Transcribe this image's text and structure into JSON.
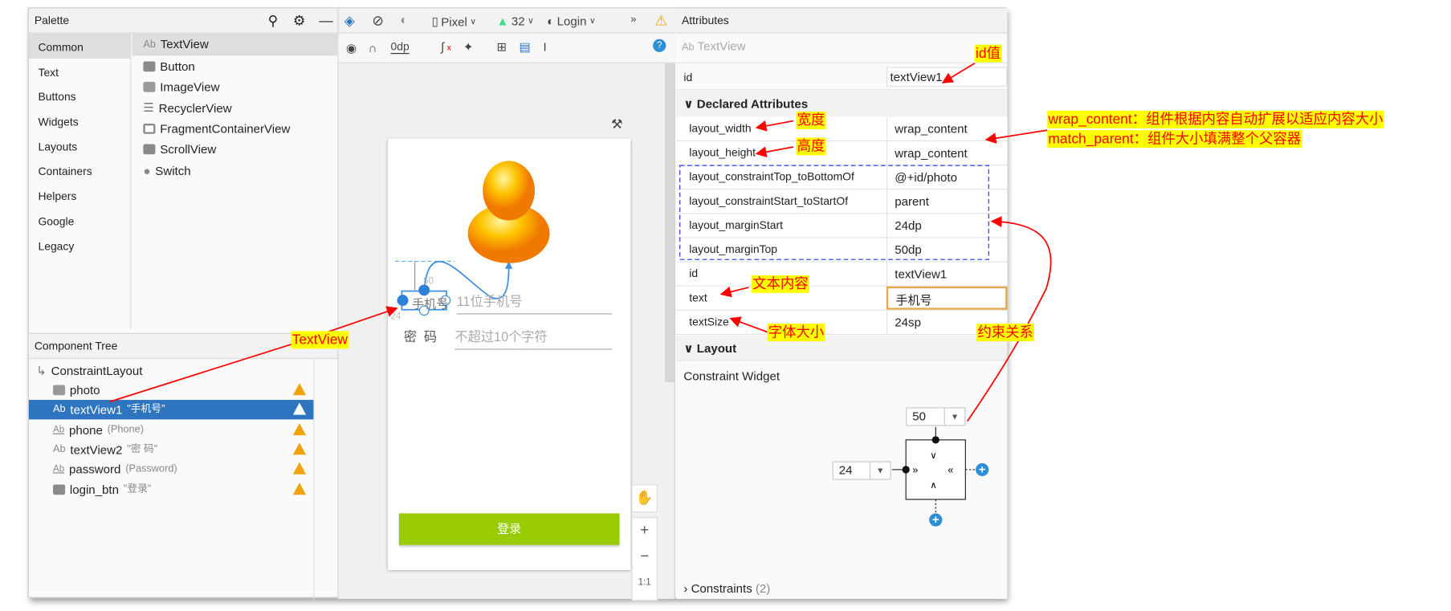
{
  "palette": {
    "title": "Palette",
    "categories": [
      "Common",
      "Text",
      "Buttons",
      "Widgets",
      "Layouts",
      "Containers",
      "Helpers",
      "Google",
      "Legacy"
    ],
    "items": [
      {
        "icon": "textview-icon",
        "label": "TextView"
      },
      {
        "icon": "button-icon",
        "label": "Button"
      },
      {
        "icon": "imageview-icon",
        "label": "ImageView"
      },
      {
        "icon": "list-icon",
        "label": "RecyclerView"
      },
      {
        "icon": "fragment-icon",
        "label": "FragmentContainerView"
      },
      {
        "icon": "scrollview-icon",
        "label": "ScrollView"
      },
      {
        "icon": "switch-icon",
        "label": "Switch"
      }
    ]
  },
  "toolbar": {
    "device": "Pixel",
    "api": "32",
    "theme": "Login",
    "margin": "0dp"
  },
  "tree": {
    "title": "Component Tree",
    "root": "ConstraintLayout",
    "rows": [
      {
        "name": "photo",
        "sub": ""
      },
      {
        "name": "textView1",
        "sub": "\"手机号\""
      },
      {
        "name": "phone",
        "sub": "(Phone)"
      },
      {
        "name": "textView2",
        "sub": "\"密   码\""
      },
      {
        "name": "password",
        "sub": "(Password)"
      },
      {
        "name": "login_btn",
        "sub": "\"登录\""
      }
    ]
  },
  "canvas": {
    "phone_label": "手机号",
    "phone_hint": "11位手机号",
    "pwd_label": "密  码",
    "pwd_hint": "不超过10个字符",
    "login": "登录",
    "margin_top_label": "50",
    "margin_start_label": "24",
    "zoom_reset": "1:1"
  },
  "attributes": {
    "title": "Attributes",
    "type_icon": "Ab",
    "type": "TextView",
    "id_label": "id",
    "id_value": "textView1",
    "declared": "Declared Attributes",
    "rows": [
      {
        "k": "layout_width",
        "v": "wrap_content"
      },
      {
        "k": "layout_height",
        "v": "wrap_content"
      },
      {
        "k": "layout_constraintTop_toBottomOf",
        "v": "@+id/photo"
      },
      {
        "k": "layout_constraintStart_toStartOf",
        "v": "parent"
      },
      {
        "k": "layout_marginStart",
        "v": "24dp"
      },
      {
        "k": "layout_marginTop",
        "v": "50dp"
      },
      {
        "k": "id",
        "v": "textView1"
      },
      {
        "k": "text",
        "v": "手机号"
      },
      {
        "k": "textSize",
        "v": "24sp"
      }
    ],
    "layout": "Layout",
    "widget": "Constraint Widget",
    "top_margin": "50",
    "start_margin": "24",
    "constraints": "Constraints",
    "constraints_count": "(2)"
  },
  "annotations": {
    "id": "id值",
    "width": "宽度",
    "height": "高度",
    "wrap": "wrap_content：组件根据内容自动扩展以适应内容大小",
    "match": "match_parent：组件大小填满整个父容器",
    "text": "文本内容",
    "textsize": "字体大小",
    "constraint": "约束关系",
    "textview": "TextView"
  },
  "colors": {
    "selection": "#2e75c0",
    "login": "#99cc00",
    "warning": "#f0a30a",
    "annotation_bg": "#ffff00",
    "annotation_text": "#ff0000"
  }
}
